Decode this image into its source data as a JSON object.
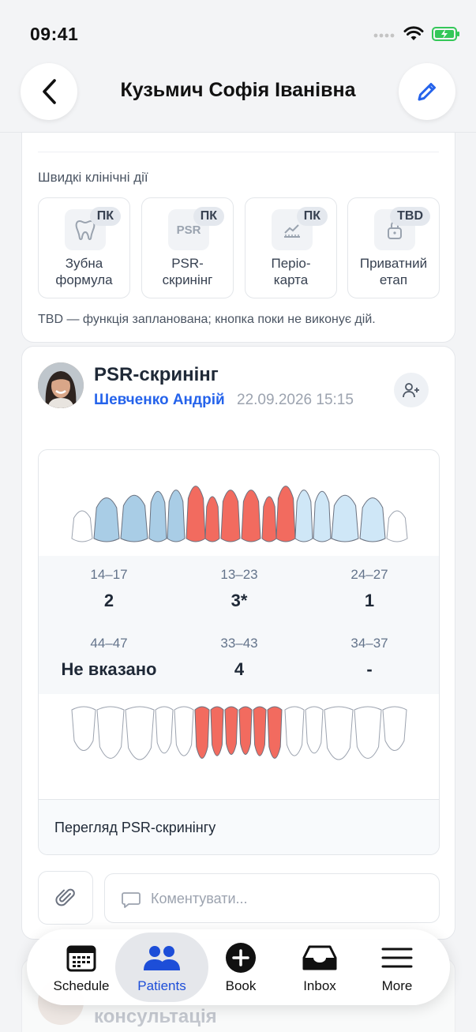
{
  "status_bar": {
    "time": "09:41"
  },
  "header": {
    "title": "Кузьмич Софія Іванівна"
  },
  "quick_actions": {
    "label": "Швидкі клінічні дії",
    "items": [
      {
        "line1": "Зубна",
        "line2": "формула",
        "badge": "ПК",
        "icon": "tooth-icon"
      },
      {
        "line1": "PSR-",
        "line2": "скринінг",
        "badge": "ПК",
        "icon": "psr-icon",
        "icon_text": "PSR"
      },
      {
        "line1": "Періо-",
        "line2": "карта",
        "badge": "ПК",
        "icon": "chart-line-icon"
      },
      {
        "line1": "Приватний",
        "line2": "етап",
        "badge": "TBD",
        "icon": "lock-icon"
      }
    ],
    "note": "TBD — функція запланована; кнопка поки не виконує дій."
  },
  "psr_card": {
    "title": "PSR-скринінг",
    "author": "Шевченко Андрій",
    "date": "22.09.2026 15:15",
    "sextants": [
      {
        "label": "14–17",
        "value": "2"
      },
      {
        "label": "13–23",
        "value": "3*"
      },
      {
        "label": "24–27",
        "value": "1"
      },
      {
        "label": "44–47",
        "value": "Не вказано"
      },
      {
        "label": "33–43",
        "value": "4"
      },
      {
        "label": "34–37",
        "value": "-"
      }
    ],
    "footer_link": "Перегляд PSR-скринінгу",
    "comment_placeholder": "Коментувати..."
  },
  "behind_card": {
    "title": "консультація"
  },
  "tab_bar": {
    "tabs": [
      {
        "label": "Schedule",
        "icon": "calendar-icon",
        "active": false
      },
      {
        "label": "Patients",
        "icon": "patients-icon",
        "active": true
      },
      {
        "label": "Book",
        "icon": "plus-circle-icon",
        "active": false
      },
      {
        "label": "Inbox",
        "icon": "inbox-icon",
        "active": false
      },
      {
        "label": "More",
        "icon": "menu-icon",
        "active": false
      }
    ]
  },
  "colors": {
    "accent": "#2563eb",
    "sextant_upper_right": "#a9cde6",
    "sextant_upper_front": "#f26b5f",
    "sextant_upper_left": "#cfe7f7",
    "sextant_lower_front": "#f26b5f"
  }
}
